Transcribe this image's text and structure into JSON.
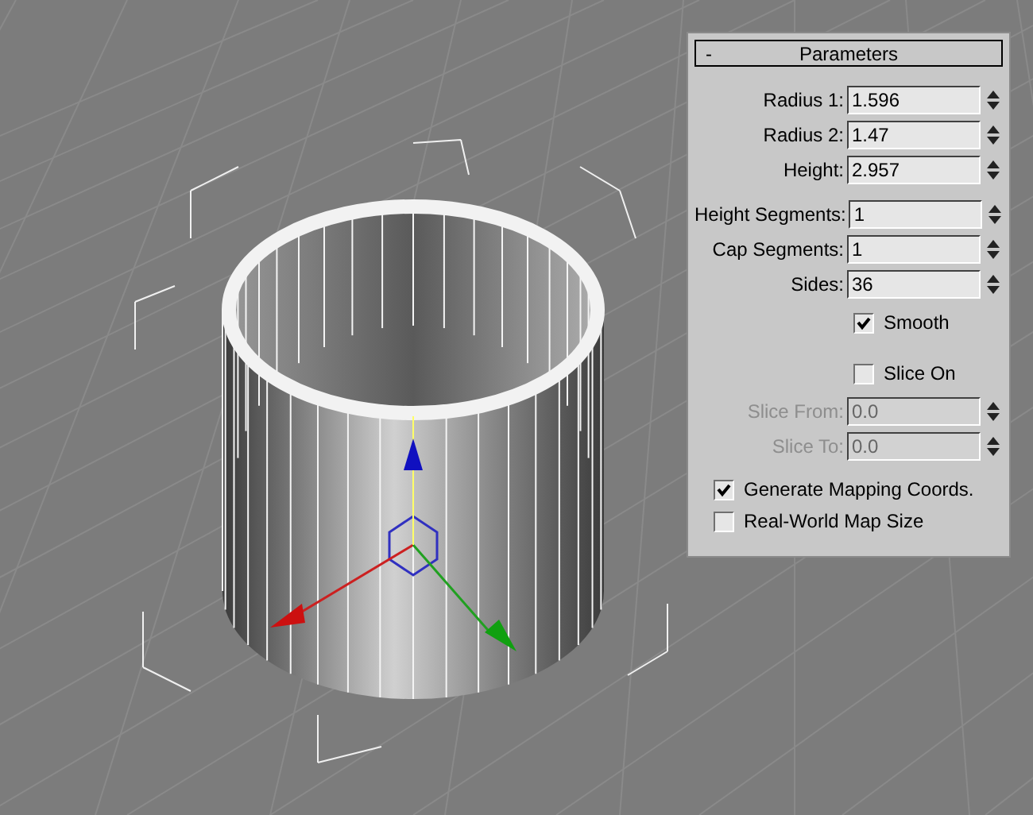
{
  "panel": {
    "collapse_symbol": "-",
    "title": "Parameters",
    "groups": [
      [
        {
          "kind": "spinner",
          "label": "Radius 1:",
          "value": "1.596",
          "disabled": false
        },
        {
          "kind": "spinner",
          "label": "Radius 2:",
          "value": "1.47",
          "disabled": false
        },
        {
          "kind": "spinner",
          "label": "Height:",
          "value": "2.957",
          "disabled": false
        }
      ],
      [
        {
          "kind": "spinner",
          "label": "Height Segments:",
          "value": "1",
          "disabled": false
        },
        {
          "kind": "spinner",
          "label": "Cap Segments:",
          "value": "1",
          "disabled": false
        },
        {
          "kind": "spinner",
          "label": "Sides:",
          "value": "36",
          "disabled": false
        },
        {
          "kind": "inline-checkbox",
          "label": "Smooth",
          "checked": true
        }
      ],
      [
        {
          "kind": "inline-checkbox",
          "label": "Slice On",
          "checked": false
        },
        {
          "kind": "spinner",
          "label": "Slice From:",
          "value": "0.0",
          "disabled": true
        },
        {
          "kind": "spinner",
          "label": "Slice To:",
          "value": "0.0",
          "disabled": true
        }
      ],
      [
        {
          "kind": "checkbox",
          "label": "Generate Mapping Coords.",
          "checked": true
        },
        {
          "kind": "checkbox",
          "label": "Real-World Map Size",
          "checked": false
        }
      ]
    ]
  }
}
